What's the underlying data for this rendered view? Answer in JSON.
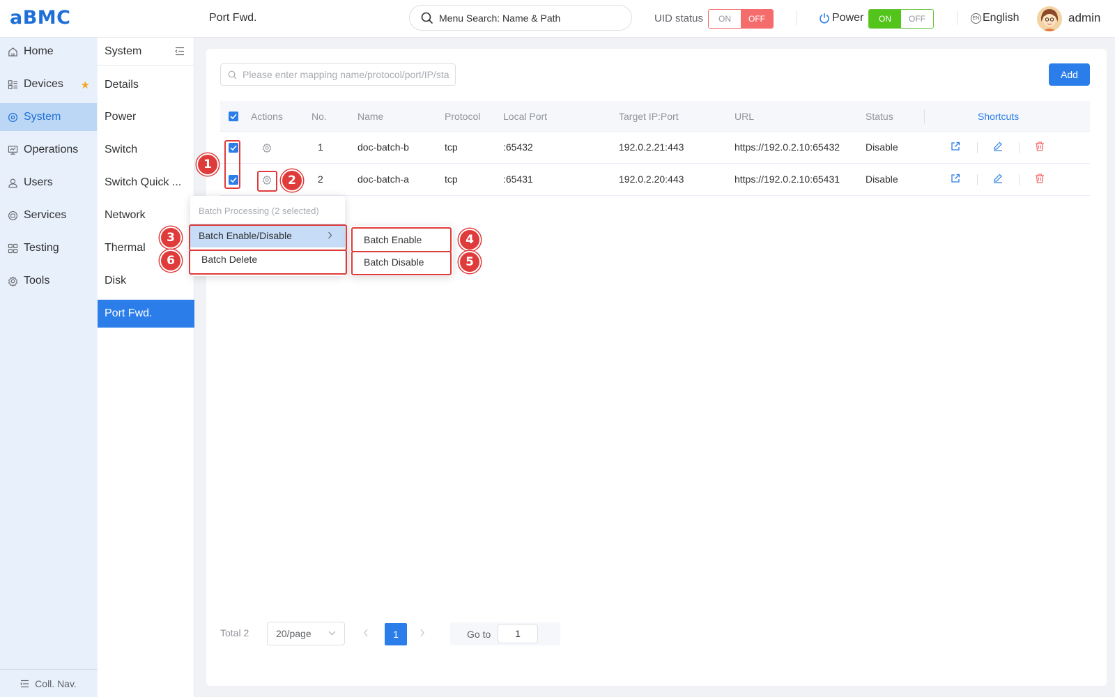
{
  "header": {
    "logo": "aBMC",
    "page_title": "Port Fwd.",
    "menu_search_placeholder": "Menu Search: Name & Path",
    "uid_status_label": "UID status",
    "uid_on": "ON",
    "uid_off": "OFF",
    "power_label": "Power",
    "power_on": "ON",
    "power_off": "OFF",
    "language_icon": "EN",
    "language": "English",
    "user": "admin"
  },
  "nav": {
    "items": [
      {
        "label": "Home",
        "icon": "home-icon"
      },
      {
        "label": "Devices",
        "icon": "devices-icon"
      },
      {
        "label": "System",
        "icon": "system-icon"
      },
      {
        "label": "Operations",
        "icon": "operations-icon"
      },
      {
        "label": "Users",
        "icon": "users-icon"
      },
      {
        "label": "Services",
        "icon": "services-icon"
      },
      {
        "label": "Testing",
        "icon": "testing-icon"
      },
      {
        "label": "Tools",
        "icon": "tools-icon"
      }
    ],
    "active": "System",
    "collapse_label": "Coll. Nav."
  },
  "subnav": {
    "title": "System",
    "items": [
      "Details",
      "Power",
      "Switch",
      "Switch Quick ...",
      "Network",
      "Thermal",
      "Disk",
      "Port Fwd."
    ],
    "active": "Port Fwd."
  },
  "toolbar": {
    "search_placeholder": "Please enter mapping name/protocol/port/IP/sta",
    "add_label": "Add"
  },
  "table": {
    "columns": [
      "Actions",
      "No.",
      "Name",
      "Protocol",
      "Local Port",
      "Target IP:Port",
      "URL",
      "Status",
      "Shortcuts"
    ],
    "rows": [
      {
        "no": "1",
        "name": "doc-batch-b",
        "protocol": "tcp",
        "local_port": ":65432",
        "target": "192.0.2.21:443",
        "url": "https://192.0.2.10:65432",
        "status": "Disable",
        "checked": true
      },
      {
        "no": "2",
        "name": "doc-batch-a",
        "protocol": "tcp",
        "local_port": ":65431",
        "target": "192.0.2.20:443",
        "url": "https://192.0.2.10:65431",
        "status": "Disable",
        "checked": true
      }
    ]
  },
  "batch_menu": {
    "header": "Batch Processing (2 selected)",
    "enable_disable": "Batch Enable/Disable",
    "delete": "Batch Delete",
    "submenu": {
      "enable": "Batch Enable",
      "disable": "Batch Disable"
    }
  },
  "pagination": {
    "total": "Total 2",
    "page_size": "20/page",
    "current_page": "1",
    "goto_label": "Go to",
    "goto_value": "1"
  },
  "annotations": [
    "1",
    "2",
    "3",
    "4",
    "5",
    "6"
  ],
  "colors": {
    "accent": "#2b7de9",
    "annotation": "#e03b3b",
    "danger": "#f56c6c",
    "success": "#52c41a"
  }
}
